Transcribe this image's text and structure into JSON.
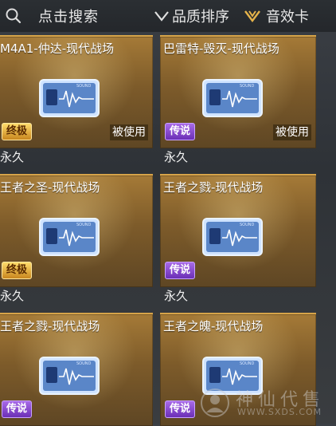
{
  "topbar": {
    "search_label": "点击搜索",
    "sort_label": "品质排序",
    "type_label": "音效卡",
    "icons": [
      "search-icon",
      "chevron-down-icon",
      "chevron-down-icon"
    ]
  },
  "cards": [
    {
      "name": "M4A1-仲达-现代战场",
      "rarity": "终极",
      "rarity_color": "gold",
      "status": "被使用",
      "duration": "永久"
    },
    {
      "name": "巴雷特-毁灭-现代战场",
      "rarity": "传说",
      "rarity_color": "purple",
      "status": "被使用",
      "duration": "永久"
    },
    {
      "name": "王者之圣-现代战场",
      "rarity": "终极",
      "rarity_color": "gold",
      "status": "",
      "duration": "永久"
    },
    {
      "name": "王者之戮-现代战场",
      "rarity": "传说",
      "rarity_color": "purple",
      "status": "",
      "duration": "永久"
    },
    {
      "name": "王者之戮-现代战场",
      "rarity": "传说",
      "rarity_color": "purple",
      "status": "",
      "duration": ""
    },
    {
      "name": "王者之魄-现代战场",
      "rarity": "传说",
      "rarity_color": "purple",
      "status": "",
      "duration": ""
    }
  ],
  "item_art": {
    "label": "SOUND",
    "icon": "sound-card-icon"
  },
  "watermark": {
    "title": "神仙代售",
    "url": "WWW.SXDS.COM"
  }
}
